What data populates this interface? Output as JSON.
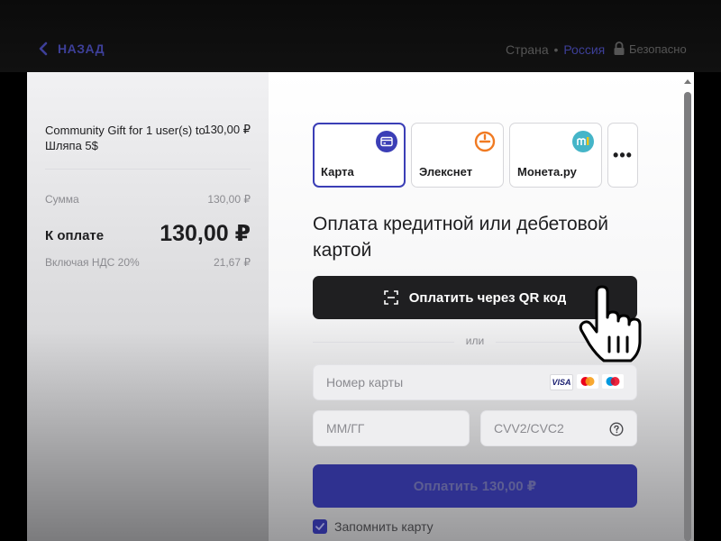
{
  "header": {
    "back_label": "НАЗАД",
    "country_label": "Страна",
    "country_separator": "•",
    "country_value": "Россия",
    "secure_label": "Безопасно"
  },
  "summary": {
    "item_name": "Community Gift for 1 user(s) to Шляпа 5$",
    "item_price": "130,00 ₽",
    "sum_label": "Сумма",
    "sum_value": "130,00 ₽",
    "pay_label": "К оплате",
    "pay_value": "130,00 ₽",
    "vat_label": "Включая НДС 20%",
    "vat_value": "21,67 ₽"
  },
  "payment": {
    "methods": [
      {
        "label": "Карта",
        "icon": "card-icon",
        "selected": true
      },
      {
        "label": "Элекснет",
        "icon": "elecsnet-logo-icon",
        "selected": false
      },
      {
        "label": "Монета.ру",
        "icon": "moneta-logo-icon",
        "selected": false
      }
    ],
    "more_label": "•••",
    "heading": "Оплата кредитной или дебетовой картой",
    "qr_button_label": "Оплатить через QR код",
    "or_label": "или",
    "card_number_placeholder": "Номер карты",
    "card_logos": [
      "VISA",
      "Mastercard",
      "Maestro"
    ],
    "visa_text": "VISA",
    "expiry_placeholder": "ММ/ГГ",
    "cvv_placeholder": "CVV2/CVC2",
    "pay_button_label": "Оплатить 130,00 ₽",
    "remember_label": "Запомнить карту",
    "remember_checked": true
  },
  "colors": {
    "accent": "#3b3eb6",
    "dark_button": "#1f1f21",
    "elecsnet_orange": "#f07a22",
    "moneta_teal": "#45b5c8"
  }
}
